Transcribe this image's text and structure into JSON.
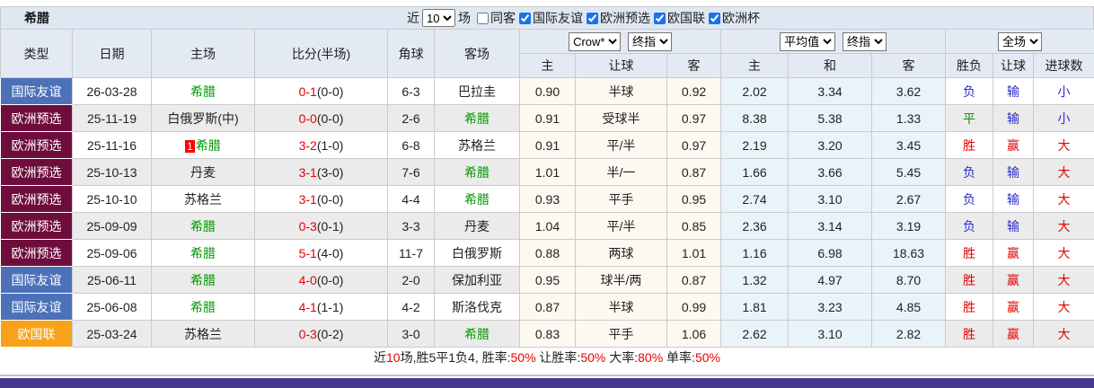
{
  "title": "希腊",
  "controls": {
    "near_label": "近",
    "matches_value": "10",
    "matches_label": "场",
    "checkboxes": [
      {
        "label": "同客",
        "checked": false
      },
      {
        "label": "国际友谊",
        "checked": true
      },
      {
        "label": "欧洲预选",
        "checked": true
      },
      {
        "label": "欧国联",
        "checked": true
      },
      {
        "label": "欧洲杯",
        "checked": true
      }
    ]
  },
  "header": {
    "type": "类型",
    "date": "日期",
    "home": "主场",
    "score": "比分(半场)",
    "corner": "角球",
    "away": "客场",
    "crow_select": "Crow*",
    "crow_final_select": "终指",
    "avg_select": "平均值",
    "avg_final_select": "终指",
    "full_select": "全场",
    "asia_home": "主",
    "asia_handicap": "让球",
    "asia_away": "客",
    "euro_home": "主",
    "euro_draw": "和",
    "euro_away": "客",
    "result_wl": "胜负",
    "result_handicap": "让球",
    "result_goals": "进球数"
  },
  "type_colors": {
    "国际友谊": "#4d71b8",
    "欧洲预选": "#6e0d3d",
    "欧国联": "#f7a218"
  },
  "colors": {
    "red": "#e60000",
    "blue": "#2b2bd0",
    "green": "#009900",
    "black": "#222222"
  },
  "rows": [
    {
      "type": "国际友谊",
      "date": "26-03-28",
      "home": {
        "name": "希腊",
        "green": true,
        "rank": ""
      },
      "score": {
        "ft": "0-1",
        "ht": "(0-0)"
      },
      "corner": "6-3",
      "away": {
        "name": "巴拉圭",
        "green": false
      },
      "crow": [
        "0.90",
        "半球",
        "0.92"
      ],
      "avg": [
        "2.02",
        "3.34",
        "3.62"
      ],
      "results": [
        {
          "t": "负",
          "c": "blue"
        },
        {
          "t": "输",
          "c": "blue"
        },
        {
          "t": "小",
          "c": "blue"
        }
      ]
    },
    {
      "type": "欧洲预选",
      "date": "25-11-19",
      "home": {
        "name": "白俄罗斯(中)",
        "green": false,
        "rank": ""
      },
      "score": {
        "ft": "0-0",
        "ht": "(0-0)"
      },
      "corner": "2-6",
      "away": {
        "name": "希腊",
        "green": true
      },
      "crow": [
        "0.91",
        "受球半",
        "0.97"
      ],
      "avg": [
        "8.38",
        "5.38",
        "1.33"
      ],
      "results": [
        {
          "t": "平",
          "c": "green"
        },
        {
          "t": "输",
          "c": "blue"
        },
        {
          "t": "小",
          "c": "blue"
        }
      ]
    },
    {
      "type": "欧洲预选",
      "date": "25-11-16",
      "home": {
        "name": "希腊",
        "green": true,
        "rank": "1"
      },
      "score": {
        "ft": "3-2",
        "ht": "(1-0)"
      },
      "corner": "6-8",
      "away": {
        "name": "苏格兰",
        "green": false
      },
      "crow": [
        "0.91",
        "平/半",
        "0.97"
      ],
      "avg": [
        "2.19",
        "3.20",
        "3.45"
      ],
      "results": [
        {
          "t": "胜",
          "c": "red"
        },
        {
          "t": "赢",
          "c": "red"
        },
        {
          "t": "大",
          "c": "red"
        }
      ]
    },
    {
      "type": "欧洲预选",
      "date": "25-10-13",
      "home": {
        "name": "丹麦",
        "green": false,
        "rank": ""
      },
      "score": {
        "ft": "3-1",
        "ht": "(3-0)"
      },
      "corner": "7-6",
      "away": {
        "name": "希腊",
        "green": true
      },
      "crow": [
        "1.01",
        "半/一",
        "0.87"
      ],
      "avg": [
        "1.66",
        "3.66",
        "5.45"
      ],
      "results": [
        {
          "t": "负",
          "c": "blue"
        },
        {
          "t": "输",
          "c": "blue"
        },
        {
          "t": "大",
          "c": "red"
        }
      ]
    },
    {
      "type": "欧洲预选",
      "date": "25-10-10",
      "home": {
        "name": "苏格兰",
        "green": false,
        "rank": ""
      },
      "score": {
        "ft": "3-1",
        "ht": "(0-0)"
      },
      "corner": "4-4",
      "away": {
        "name": "希腊",
        "green": true
      },
      "crow": [
        "0.93",
        "平手",
        "0.95"
      ],
      "avg": [
        "2.74",
        "3.10",
        "2.67"
      ],
      "results": [
        {
          "t": "负",
          "c": "blue"
        },
        {
          "t": "输",
          "c": "blue"
        },
        {
          "t": "大",
          "c": "red"
        }
      ]
    },
    {
      "type": "欧洲预选",
      "date": "25-09-09",
      "home": {
        "name": "希腊",
        "green": true,
        "rank": ""
      },
      "score": {
        "ft": "0-3",
        "ht": "(0-1)"
      },
      "corner": "3-3",
      "away": {
        "name": "丹麦",
        "green": false
      },
      "crow": [
        "1.04",
        "平/半",
        "0.85"
      ],
      "avg": [
        "2.36",
        "3.14",
        "3.19"
      ],
      "results": [
        {
          "t": "负",
          "c": "blue"
        },
        {
          "t": "输",
          "c": "blue"
        },
        {
          "t": "大",
          "c": "red"
        }
      ]
    },
    {
      "type": "欧洲预选",
      "date": "25-09-06",
      "home": {
        "name": "希腊",
        "green": true,
        "rank": ""
      },
      "score": {
        "ft": "5-1",
        "ht": "(4-0)"
      },
      "corner": "11-7",
      "away": {
        "name": "白俄罗斯",
        "green": false
      },
      "crow": [
        "0.88",
        "两球",
        "1.01"
      ],
      "avg": [
        "1.16",
        "6.98",
        "18.63"
      ],
      "results": [
        {
          "t": "胜",
          "c": "red"
        },
        {
          "t": "赢",
          "c": "red"
        },
        {
          "t": "大",
          "c": "red"
        }
      ]
    },
    {
      "type": "国际友谊",
      "date": "25-06-11",
      "home": {
        "name": "希腊",
        "green": true,
        "rank": ""
      },
      "score": {
        "ft": "4-0",
        "ht": "(0-0)"
      },
      "corner": "2-0",
      "away": {
        "name": "保加利亚",
        "green": false
      },
      "crow": [
        "0.95",
        "球半/两",
        "0.87"
      ],
      "avg": [
        "1.32",
        "4.97",
        "8.70"
      ],
      "results": [
        {
          "t": "胜",
          "c": "red"
        },
        {
          "t": "赢",
          "c": "red"
        },
        {
          "t": "大",
          "c": "red"
        }
      ]
    },
    {
      "type": "国际友谊",
      "date": "25-06-08",
      "home": {
        "name": "希腊",
        "green": true,
        "rank": ""
      },
      "score": {
        "ft": "4-1",
        "ht": "(1-1)"
      },
      "corner": "4-2",
      "away": {
        "name": "斯洛伐克",
        "green": false
      },
      "crow": [
        "0.87",
        "半球",
        "0.99"
      ],
      "avg": [
        "1.81",
        "3.23",
        "4.85"
      ],
      "results": [
        {
          "t": "胜",
          "c": "red"
        },
        {
          "t": "赢",
          "c": "red"
        },
        {
          "t": "大",
          "c": "red"
        }
      ]
    },
    {
      "type": "欧国联",
      "date": "25-03-24",
      "home": {
        "name": "苏格兰",
        "green": false,
        "rank": ""
      },
      "score": {
        "ft": "0-3",
        "ht": "(0-2)"
      },
      "corner": "3-0",
      "away": {
        "name": "希腊",
        "green": true
      },
      "crow": [
        "0.83",
        "平手",
        "1.06"
      ],
      "avg": [
        "2.62",
        "3.10",
        "2.82"
      ],
      "results": [
        {
          "t": "胜",
          "c": "red"
        },
        {
          "t": "赢",
          "c": "red"
        },
        {
          "t": "大",
          "c": "red"
        }
      ]
    }
  ],
  "footer": {
    "segments": [
      {
        "t": "近",
        "c": "black"
      },
      {
        "t": "10",
        "c": "red"
      },
      {
        "t": "场,胜5平1负4, 胜率:",
        "c": "black"
      },
      {
        "t": "50%",
        "c": "red"
      },
      {
        "t": " 让胜率:",
        "c": "black"
      },
      {
        "t": "50%",
        "c": "red"
      },
      {
        "t": " 大率:",
        "c": "black"
      },
      {
        "t": "80%",
        "c": "red"
      },
      {
        "t": " 单率:",
        "c": "black"
      },
      {
        "t": "50%",
        "c": "red"
      }
    ]
  }
}
